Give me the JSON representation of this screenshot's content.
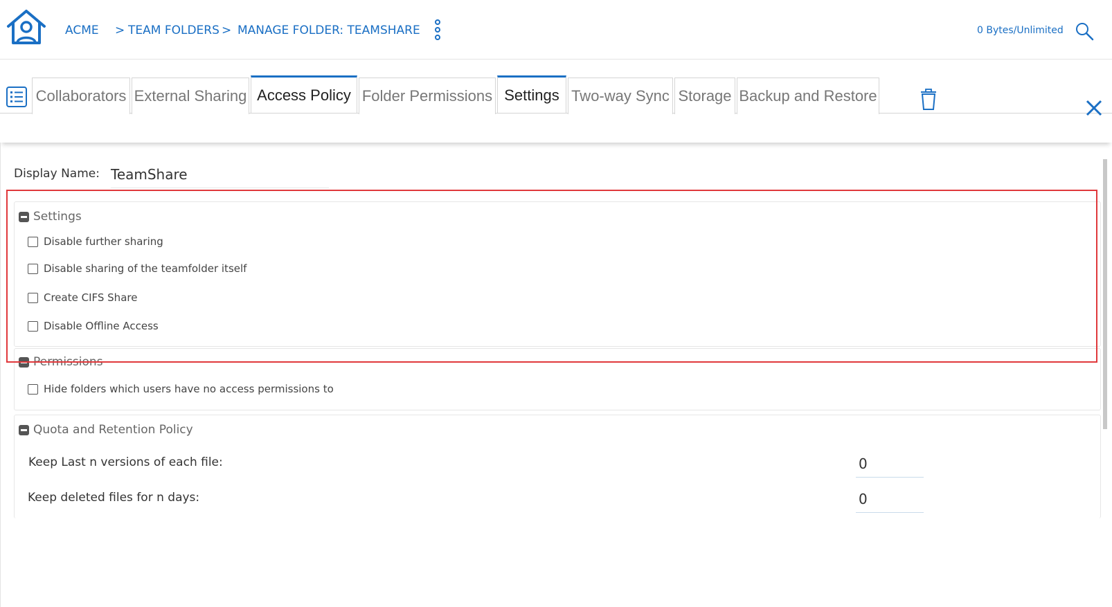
{
  "header": {
    "company": "ACME",
    "crumb_sep_1": ">",
    "crumb_team_folders": "TEAM FOLDERS",
    "crumb_sep_2": ">",
    "crumb_manage": "MANAGE FOLDER: TEAMSHARE",
    "quota": "0 Bytes/Unlimited"
  },
  "tabs": [
    {
      "label": "Collaborators"
    },
    {
      "label": "External Sharing"
    },
    {
      "label": "Access Policy"
    },
    {
      "label": "Folder Permissions"
    },
    {
      "label": "Settings"
    },
    {
      "label": "Two-way Sync"
    },
    {
      "label": "Storage"
    },
    {
      "label": "Backup and Restore"
    }
  ],
  "display_name": {
    "label": "Display Name:",
    "value": "TeamShare"
  },
  "settings": {
    "title": "Settings",
    "options": [
      {
        "label": "Disable further sharing",
        "checked": false
      },
      {
        "label": "Disable sharing of the teamfolder itself",
        "checked": false
      },
      {
        "label": "Create CIFS Share",
        "checked": false
      },
      {
        "label": "Disable Offline Access",
        "checked": false
      }
    ]
  },
  "permissions": {
    "title": "Permissions",
    "options": [
      {
        "label": "Hide folders which users have no access permissions to",
        "checked": false
      }
    ]
  },
  "quota_policy": {
    "title": "Quota and Retention Policy",
    "fields": [
      {
        "label": "Keep Last n versions of each file:",
        "value": "0"
      },
      {
        "label": "Keep deleted files for n days:",
        "value": "0"
      }
    ]
  },
  "colors": {
    "accent": "#1a6fc4",
    "highlight_border": "#e0383b"
  },
  "icons": [
    "home-icon",
    "kebab-menu-icon",
    "search-icon",
    "list-icon",
    "trash-icon",
    "close-icon",
    "minus-icon"
  ]
}
